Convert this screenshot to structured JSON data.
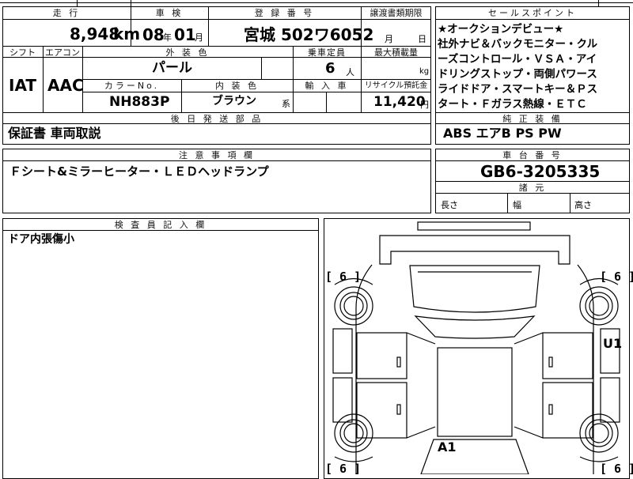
{
  "mileage": {
    "header": "走 行",
    "value": "8,948",
    "unit": "km"
  },
  "shaken": {
    "header": "車 検",
    "year": "08",
    "year_unit": "年",
    "month": "01",
    "month_unit": "月"
  },
  "registration": {
    "header": "登 録 番 号",
    "value": "宮城 502ワ6052"
  },
  "transfer_deadline": {
    "header": "譲渡書類期限",
    "month_unit": "月",
    "day_unit": "日"
  },
  "sales_points": {
    "header": "セールスポイント",
    "lines": [
      "★オークションデビュー★",
      "社外ナビ＆バックモニター・クル",
      "ーズコントロール・ＶＳＡ・アイ",
      "ドリングストップ・両側パワース",
      "ライドドア・スマートキー＆Ｐス",
      "タート・Ｆガラス熱線・ＥＴＣ"
    ]
  },
  "shift": {
    "header": "シフト",
    "value": "IAT"
  },
  "aircon": {
    "header": "エアコン",
    "value": "AAC"
  },
  "exterior_color": {
    "header": "外 装 色",
    "value": "パール"
  },
  "capacity": {
    "header": "乗車定員",
    "value": "6",
    "unit": "人"
  },
  "max_load": {
    "header": "最大積載量",
    "unit": "kg"
  },
  "color_no": {
    "header": "カラーNo.",
    "value": "NH883P"
  },
  "interior_color": {
    "header": "内 装 色",
    "value": "ブラウン",
    "suffix": "系"
  },
  "import": {
    "header": "輸 入 車"
  },
  "recycle": {
    "header": "リサイクル預託金",
    "value": "11,420",
    "unit": "円"
  },
  "standard_equipment": {
    "header": "純 正 装 備",
    "value": "ABS エアB PS PW"
  },
  "later_parts": {
    "header": "後 日 発 送 部 品",
    "value": "保証書 車両取説"
  },
  "notes": {
    "header": "注 意 事 項 欄",
    "value": "Ｆシート&ミラーヒーター・ＬＥＤヘッドランプ"
  },
  "chassis": {
    "header": "車 台 番 号",
    "value": "GB6-3205335"
  },
  "dimensions": {
    "header": "諸 元",
    "length": "長さ",
    "width": "幅",
    "height": "高さ"
  },
  "inspector": {
    "header": "検 査 員 記 入 欄",
    "value": "ドア内張傷小"
  },
  "diagram": {
    "tl": "[ 6 ]",
    "tr": "[ 6 ]",
    "bl": "[ 6 ]",
    "br": "[ 6 ]",
    "u1": "U1",
    "a1": "A1"
  }
}
